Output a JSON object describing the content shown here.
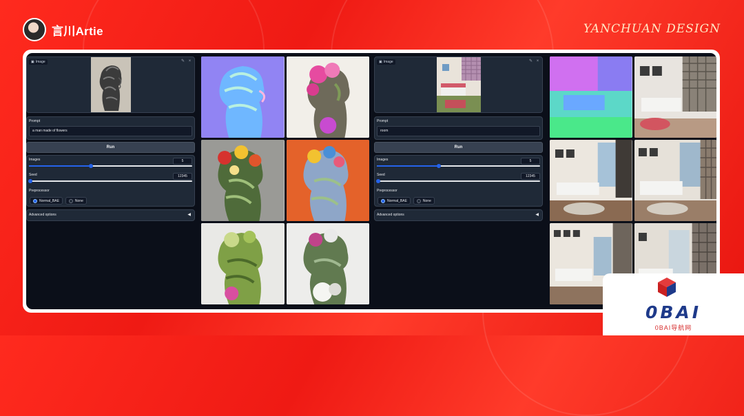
{
  "header": {
    "brand_name": "言川Artie",
    "signature": "YANCHUAN DESIGN"
  },
  "left_app": {
    "image_label": "Image",
    "prompt_label": "Prompt",
    "prompt_value": "a man made of flowers",
    "run_label": "Run",
    "images_label": "Images",
    "images_value": "5",
    "images_fraction": 0.38,
    "seed_label": "Seed",
    "seed_value": "12345",
    "seed_fraction": 0.01,
    "preprocessor_label": "Preprocessor",
    "options": [
      "Normal_BAE",
      "None"
    ],
    "selected_option": "Normal_BAE",
    "advanced_label": "Advanced options"
  },
  "right_app": {
    "image_label": "Image",
    "prompt_label": "Prompt",
    "prompt_value": "room",
    "run_label": "Run",
    "images_label": "Images",
    "images_value": "5",
    "images_fraction": 0.38,
    "seed_label": "Seed",
    "seed_value": "12345",
    "seed_fraction": 0.01,
    "preprocessor_label": "Preprocessor",
    "options": [
      "Normal_BAE",
      "None"
    ],
    "selected_option": "Normal_BAE",
    "advanced_label": "Advanced options"
  },
  "watermark": {
    "logo_text": "0BAI",
    "sub_text": "0BAI导航网"
  },
  "colors": {
    "accent_blue": "#2563eb",
    "background_red": "#ff2a1e",
    "app_bg": "#0b0f19"
  }
}
